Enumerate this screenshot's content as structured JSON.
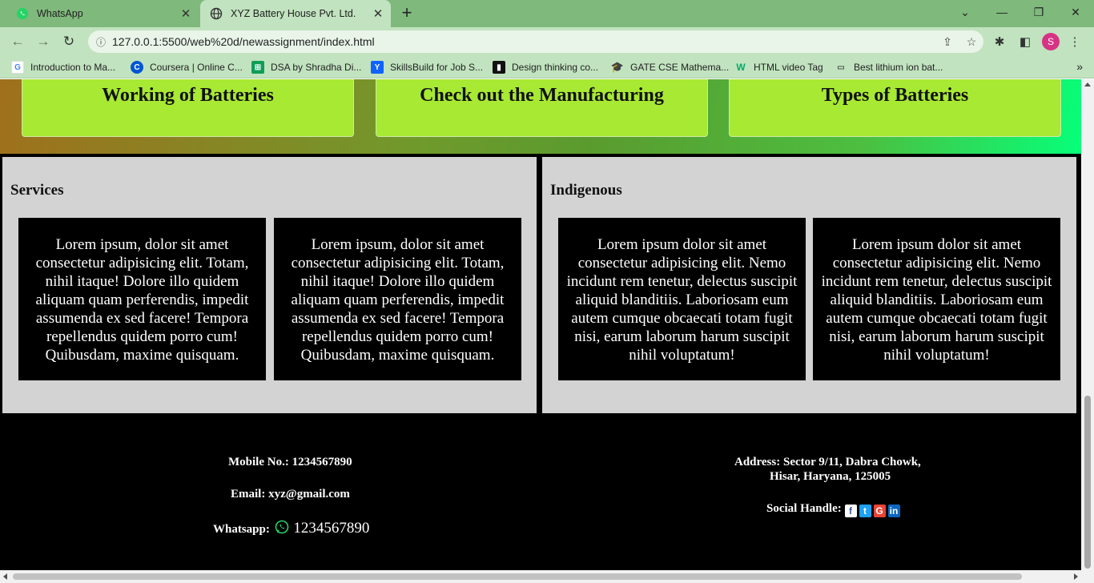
{
  "browser": {
    "tabs": [
      {
        "title": "WhatsApp",
        "favicon": "whatsapp-icon"
      },
      {
        "title": "XYZ Battery House Pvt. Ltd.",
        "favicon": "globe-icon"
      }
    ],
    "url": "127.0.0.1:5500/web%20d/newassignment/index.html",
    "profile_initial": "S",
    "bookmarks": [
      {
        "label": "Introduction to Ma...",
        "icon": "google-icon"
      },
      {
        "label": "Coursera | Online C...",
        "icon": "coursera-icon"
      },
      {
        "label": "DSA by Shradha Di...",
        "icon": "sheets-icon"
      },
      {
        "label": "SkillsBuild for Job S...",
        "icon": "skillsbuild-icon"
      },
      {
        "label": "Design thinking co...",
        "icon": "design-icon"
      },
      {
        "label": "GATE CSE Mathema...",
        "icon": "graduation-cap-icon"
      },
      {
        "label": "HTML video Tag",
        "icon": "w3-icon"
      },
      {
        "label": "Best lithium ion bat...",
        "icon": "battery-icon"
      }
    ]
  },
  "page": {
    "hero_cards": [
      "Working of Batteries",
      "Check out the Manufacturing",
      "Types of Batteries"
    ],
    "sections": [
      {
        "title": "Services",
        "boxes": [
          "Lorem ipsum, dolor sit amet consectetur adipisicing elit. Totam, nihil itaque! Dolore illo quidem aliquam quam perferendis, impedit assumenda ex sed facere! Tempora repellendus quidem porro cum! Quibusdam, maxime quisquam.",
          "Lorem ipsum, dolor sit amet consectetur adipisicing elit. Totam, nihil itaque! Dolore illo quidem aliquam quam perferendis, impedit assumenda ex sed facere! Tempora repellendus quidem porro cum! Quibusdam, maxime quisquam."
        ]
      },
      {
        "title": "Indigenous",
        "boxes": [
          "Lorem ipsum dolor sit amet consectetur adipisicing elit. Nemo incidunt rem tenetur, delectus suscipit aliquid blanditiis. Laboriosam eum autem cumque obcaecati totam fugit nisi, earum laborum harum suscipit nihil voluptatum!",
          "Lorem ipsum dolor sit amet consectetur adipisicing elit. Nemo incidunt rem tenetur, delectus suscipit aliquid blanditiis. Laboriosam eum autem cumque obcaecati totam fugit nisi, earum laborum harum suscipit nihil voluptatum!"
        ]
      }
    ],
    "footer": {
      "mobile": "Mobile No.: 1234567890",
      "email": "Email: xyz@gmail.com",
      "whatsapp_label": "Whatsapp:",
      "whatsapp_number": "1234567890",
      "address_line1": "Address: Sector 9/11, Dabra Chowk,",
      "address_line2": "Hisar, Haryana, 125005",
      "social_label": "Social Handle:",
      "social_icons": [
        "facebook-icon",
        "twitter-icon",
        "google-icon",
        "linkedin-icon"
      ]
    }
  },
  "colors": {
    "tabbar": "#7fb97c",
    "toolbar": "#c1e3bf",
    "hero_card": "#a8e933",
    "panel": "#d3d3d3",
    "box": "#000000",
    "footer": "#000000",
    "whatsapp_green": "#25d366"
  }
}
